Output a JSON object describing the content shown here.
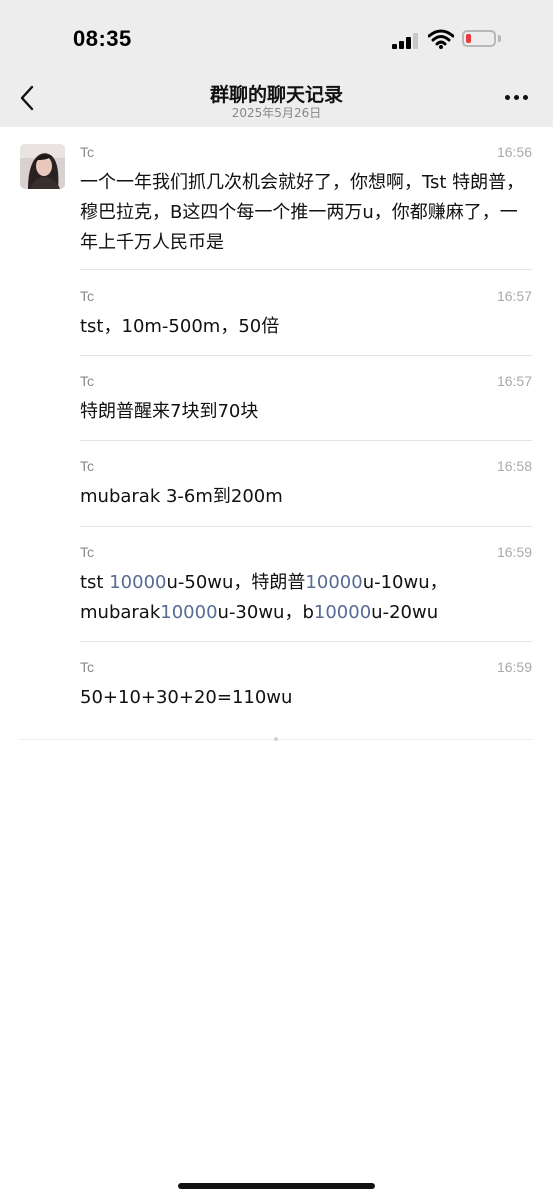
{
  "status_bar": {
    "time": "08:35",
    "battery_color": "#ea3b3b"
  },
  "nav": {
    "title": "群聊的聊天记录",
    "subtitle": "2025年5月26日",
    "back_icon": "chevron-left-icon",
    "more_icon": "ellipsis-icon"
  },
  "messages": [
    {
      "sender": "Tc",
      "time": "16:56",
      "text": "一个一年我们抓几次机会就好了，你想啊，Tst 特朗普，穆巴拉克，B这四个每一个推一两万u，你都赚麻了，一年上千万人民币是"
    },
    {
      "sender": "Tc",
      "time": "16:57",
      "text": "tst，10m-500m，50倍"
    },
    {
      "sender": "Tc",
      "time": "16:57",
      "text": "特朗普醒来7块到70块"
    },
    {
      "sender": "Tc",
      "time": "16:58",
      "text": "mubarak 3-6m到200m"
    },
    {
      "sender": "Tc",
      "time": "16:59",
      "segments": [
        "tst ",
        "10000",
        "u-50wu，特朗普",
        "10000",
        "u-10wu，mubarak",
        "10000",
        "u-30wu，b",
        "10000",
        "u-20wu"
      ]
    },
    {
      "sender": "Tc",
      "time": "16:59",
      "text": "50+10+30+20=110wu"
    }
  ],
  "colors": {
    "link": "#576b95",
    "header_bg": "#ededed"
  }
}
